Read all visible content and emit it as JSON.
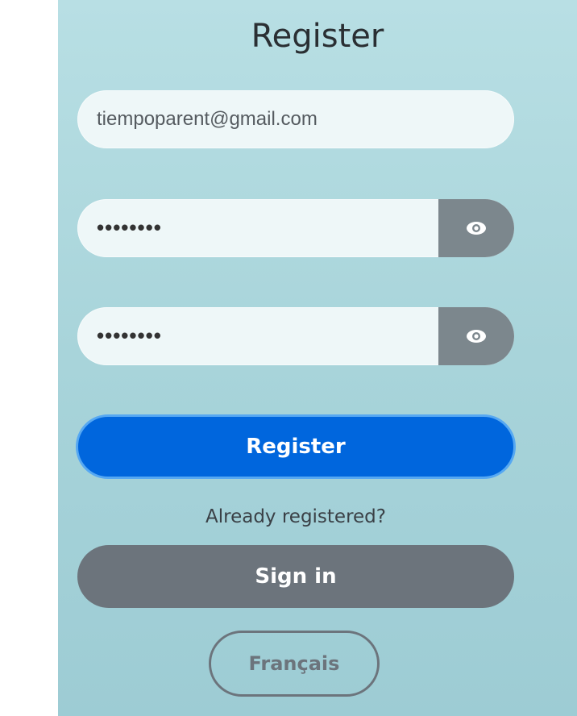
{
  "form": {
    "title": "Register",
    "email_value": "tiempoparent@gmail.com",
    "password_value": "••••••••",
    "confirm_password_value": "••••••••",
    "register_label": "Register",
    "already_registered_text": "Already registered?",
    "sign_in_label": "Sign in",
    "language_label": "Français"
  },
  "icons": {
    "show_password": "eye-icon",
    "show_confirm_password": "eye-icon"
  },
  "colors": {
    "primary": "#0066dd",
    "secondary": "#6c747c",
    "eye_button": "#7c878d",
    "background_top": "#b8dfe4",
    "background_bottom": "#9dccd4"
  }
}
